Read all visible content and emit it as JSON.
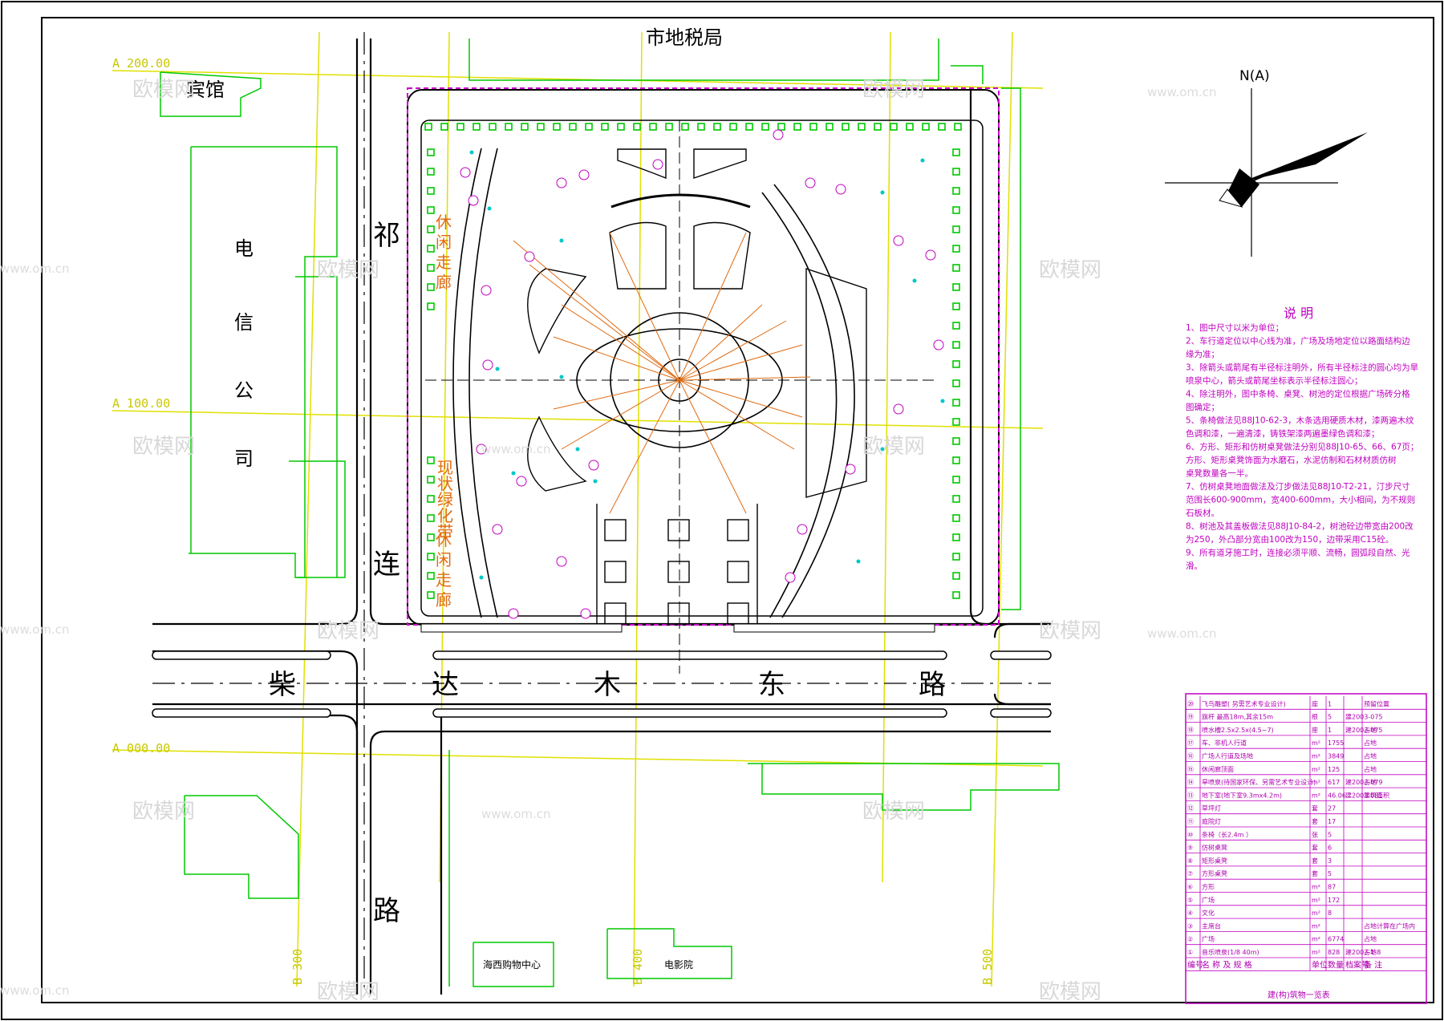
{
  "plan": {
    "top_neighbor": "市地税局",
    "hotel": "宾馆",
    "telecom": [
      "电",
      "信",
      "公",
      "司"
    ],
    "road_west": [
      "祁",
      "连",
      "路"
    ],
    "road_south": [
      "柴",
      "达",
      "木",
      "东",
      "路"
    ],
    "corridor_north": [
      "休",
      "闲",
      "走",
      "廊"
    ],
    "corridor_south": [
      "休",
      "闲",
      "走",
      "廊"
    ],
    "green_belt": [
      "现",
      "状",
      "绿",
      "化",
      "带"
    ],
    "shopping_center": "海西购物中心",
    "cinema": "电影院",
    "grid_labels": {
      "a200": "A 200.00",
      "a100": "A 100.00",
      "a000": "A 000.00",
      "b300": "B 300",
      "b400": "B 400",
      "b500": "B 500"
    },
    "north_label": "N(A)"
  },
  "notes": {
    "title": "说  明",
    "lines": [
      "1、图中尺寸以米为单位；",
      "2、车行道定位以中心线为准，广场及场地定位以路面结构边",
      "   缘为准；",
      "3、除箭头或箭尾有半径标注明外，所有半径标注的圆心均为旱",
      "   喷泉中心，箭头或箭尾坐标表示半径标注圆心；",
      "4、除注明外，图中条椅、桌凳、树池的定位根据广场砖分格",
      "   图确定；",
      "5、条椅做法见88J10-62-3，木条选用硬质木材，漆两遍木纹",
      "   色调和漆，一遍清漆，铸铁架漆两遍墨绿色调和漆；",
      "6、方形、矩形和仿树桌凳做法分别见88J10-65、66、67页；",
      "   方形、矩形桌凳饰面为水磨石，水泥仿制和石材材质仿树",
      "   桌凳数量各一半。",
      "7、仿树桌凳地面做法及汀步做法见88J10-T2-21，汀步尺寸",
      "   范围长600-900mm，宽400-600mm，大小相间，为不规则",
      "   石板材。",
      "8、树池及其盖板做法见88J10-84-2，树池砼边带宽由200改",
      "   为250，外凸部分宽由100改为150，边带采用C15砼。",
      "9、所有道牙施工时，连接必须平顺、流畅，圆弧段自然、光",
      "   滑。"
    ]
  },
  "table": {
    "title": "建(构)筑物一览表",
    "header": [
      "编号",
      "名 称 及 规 格",
      "单位",
      "数量",
      "档案号",
      "备  注"
    ],
    "rows": [
      [
        "⑳",
        "飞鸟雕塑( 另需艺术专业设计)",
        "座",
        "1",
        "",
        "预留位置"
      ],
      [
        "⑲",
        "旗杆 最高18m,其余15m",
        "根",
        "5",
        "建2003-075",
        ""
      ],
      [
        "⑱",
        "喷水槽2.5x2.5x(4.5~7)",
        "座",
        "1",
        "建2003-075",
        "占地"
      ],
      [
        "⑰",
        "车、非机人行道",
        "m²",
        "1755",
        "",
        "占地"
      ],
      [
        "⑯",
        "广场人行道及场地",
        "m²",
        "3849",
        "",
        "占地"
      ],
      [
        "⑮",
        "休闲廊顶面",
        "m²",
        "125",
        "",
        "占地"
      ],
      [
        "⑭",
        "旱喷泉(待国家环保、另需艺术专业设计)",
        "m²",
        "617",
        "建2003-079",
        "占地"
      ],
      [
        "⑬",
        "地下室(地下室9.3mx4.2m)",
        "m²",
        "46.06",
        "建2003-081",
        "建筑面积"
      ],
      [
        "⑫",
        "草坪灯",
        "套",
        "27",
        "",
        ""
      ],
      [
        "⑪",
        "庭院灯",
        "套",
        "17",
        "",
        ""
      ],
      [
        "⑩",
        "条椅（长2.4m ）",
        "张",
        "5",
        "",
        ""
      ],
      [
        "⑨",
        "仿树桌凳",
        "套",
        "6",
        "",
        ""
      ],
      [
        "⑧",
        "矩形桌凳",
        "套",
        "3",
        "",
        ""
      ],
      [
        "⑦",
        "方形桌凳",
        "套",
        "5",
        "",
        ""
      ],
      [
        "⑥",
        "方形",
        "m²",
        "87",
        "",
        ""
      ],
      [
        "⑤",
        "广场",
        "m²",
        "172",
        "",
        ""
      ],
      [
        "④",
        "文化",
        "m²",
        "8",
        "",
        ""
      ],
      [
        "③",
        "主席台",
        "m²",
        "",
        "",
        "占地计算在广场内"
      ],
      [
        "②",
        "广场",
        "m²",
        "6774",
        "",
        "占地"
      ],
      [
        "①",
        "音乐喷泉(1/8 40m)",
        "m²",
        "828",
        "建2003-1-8",
        "占地"
      ]
    ]
  },
  "watermark": {
    "brand": "欧模网",
    "url": "www.om.cn"
  },
  "colors": {
    "cad_black": "#000000",
    "road_line": "#000000",
    "greenery": "#00c800",
    "axis_yellow": "#e0e000",
    "magenta": "#c000c0",
    "orange_dim": "#e06a10",
    "cyan_marker": "#00c8c8"
  }
}
